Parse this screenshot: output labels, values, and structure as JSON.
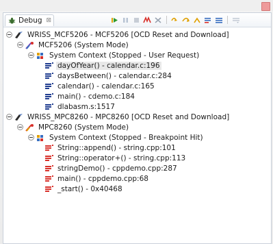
{
  "view": {
    "tab_label": "Debug",
    "tab_close": "⊠",
    "toolbar_icons": [
      "resume-icon",
      "suspend-icon",
      "terminate-icon",
      "disconnect-icon",
      "remove-terminated-icon",
      "step-into-icon",
      "step-over-icon",
      "step-return-icon",
      "drop-to-frame-icon",
      "use-step-filters-icon",
      "view-menu-icon"
    ]
  },
  "tree": {
    "launch1": {
      "label": "WRISS_MCF5206 - MCF5206 [OCD Reset and Download]"
    },
    "target1": {
      "label": "MCF5206 (System Mode)"
    },
    "thread1": {
      "label": "System Context (Stopped - User Request)"
    },
    "frames1": [
      {
        "label": "dayOfYear() - calendar.c:196"
      },
      {
        "label": "daysBetween() - calendar.c:284"
      },
      {
        "label": "calendar() - calendar.c:165"
      },
      {
        "label": "main() - cdemo.c:184"
      },
      {
        "label": "dlabasm.s:1517"
      }
    ],
    "launch2": {
      "label": "WRISS_MPC8260 - MPC8260 [OCD Reset and Download]"
    },
    "target2": {
      "label": "MPC8260 (System Mode)"
    },
    "thread2": {
      "label": "System Context (Stopped - Breakpoint Hit)"
    },
    "frames2": [
      {
        "label": "String::append() - string.cpp:101"
      },
      {
        "label": "String::operator+() - string.cpp:113"
      },
      {
        "label": "stringDemo() - cppdemo.cpp:287"
      },
      {
        "label": "main() - cppdemo.cpp:68"
      },
      {
        "label": "_start() - 0x40468"
      }
    ]
  },
  "colors": {
    "frame_blue": "#1f3c8f",
    "frame_red": "#d8302a"
  }
}
